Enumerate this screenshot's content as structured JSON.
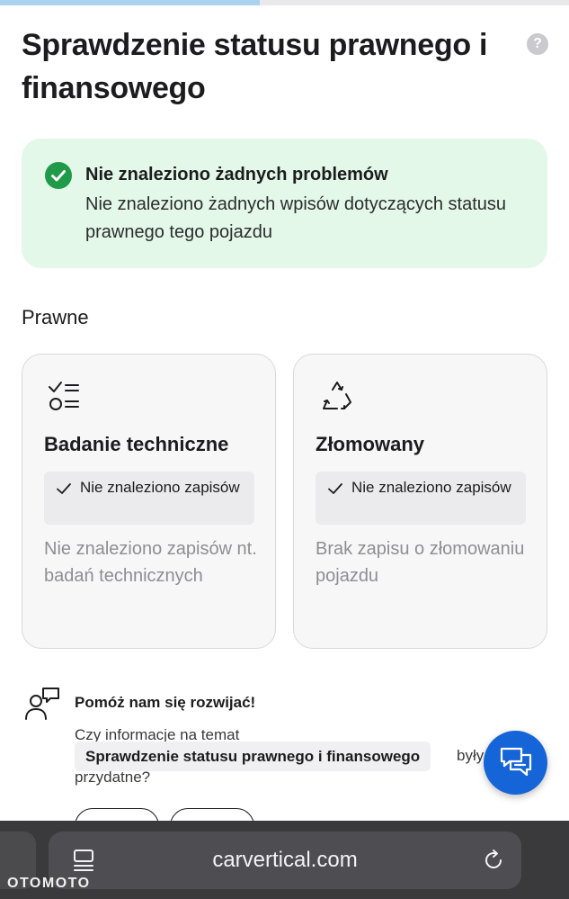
{
  "progress": {
    "fraction": 0.456
  },
  "page": {
    "title": "Sprawdzenie statusu prawnego i finansowego",
    "help_icon": "question-mark-icon",
    "help_glyph": "?"
  },
  "alert": {
    "icon": "check-circle-icon",
    "title": "Nie znaleziono żadnych problemów",
    "text": "Nie znaleziono żadnych wpisów dotyczących statusu prawnego tego pojazdu",
    "colors": {
      "background": "#e3f8e9",
      "icon": "#1f9a48"
    }
  },
  "legal": {
    "section_title": "Prawne",
    "cards": [
      {
        "icon": "checklist-icon",
        "title": "Badanie techniczne",
        "status": "Nie znaleziono zapisów",
        "description": "Nie znaleziono zapisów nt. badań technicznych"
      },
      {
        "icon": "recycle-icon",
        "title": "Złomowany",
        "status": "Nie znaleziono zapisów",
        "description": "Brak zapisu o złomowaniu pojazdu"
      }
    ]
  },
  "feedback": {
    "icon": "user-chat-icon",
    "title": "Pomóż nam się rozwijać!",
    "question_start": "Czy informacje na temat",
    "topic": "Sprawdzenie statusu prawnego i finansowego",
    "question_mid": "były",
    "question_end": "przydatne?"
  },
  "chat_button": {
    "icon": "chat-bubbles-icon",
    "color": "#1565d8"
  },
  "browser": {
    "url": "carvertical.com",
    "tabs_icon": "tabs-icon",
    "reload_icon": "reload-icon"
  },
  "watermark": "OTOMOTO"
}
